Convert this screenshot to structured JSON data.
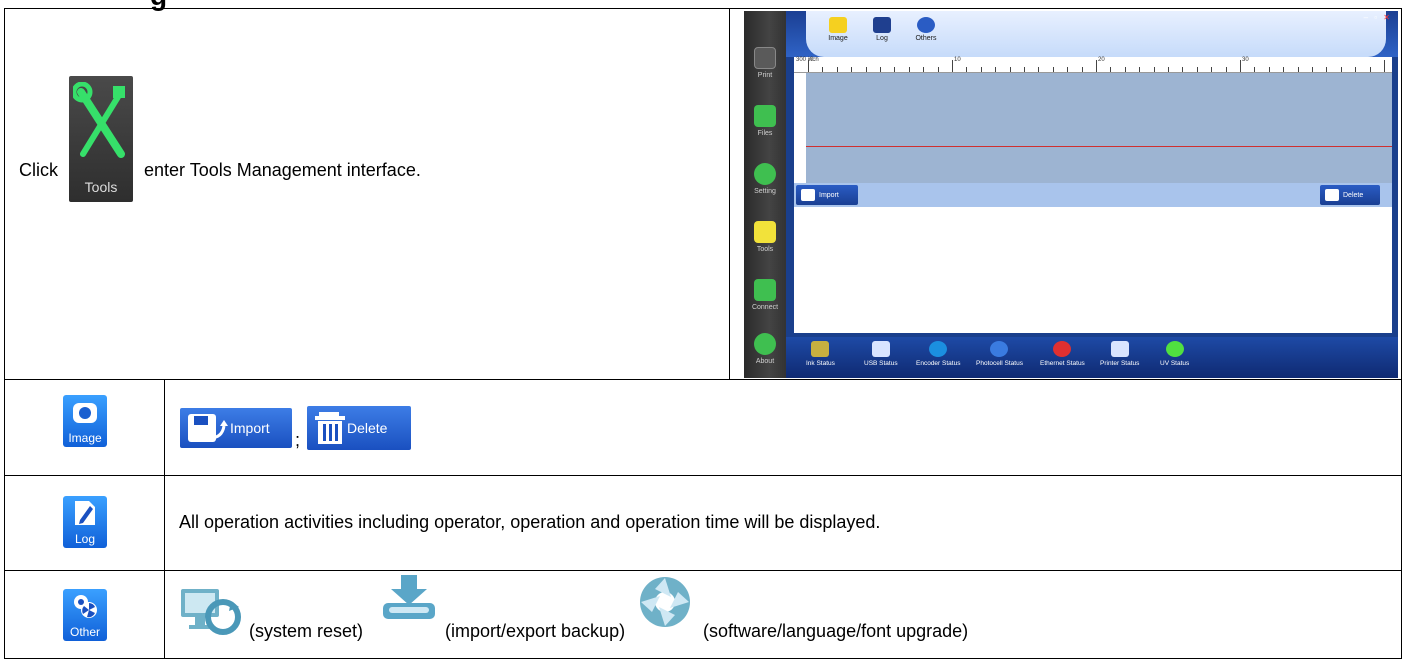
{
  "doc": {
    "heading_fragment": "g",
    "intro": {
      "before": "Click",
      "tools_icon_label": "Tools",
      "after": "enter Tools Management interface."
    },
    "app_screenshot": {
      "sidebar": [
        "Print",
        "Files",
        "Setting",
        "Tools",
        "Connect",
        "About"
      ],
      "top_buttons": [
        "Image",
        "Log",
        "Others"
      ],
      "ruler": {
        "corner": "300\ninch",
        "marks": [
          "0",
          "10",
          "20",
          "30"
        ]
      },
      "import_label": "Import",
      "delete_label": "Delete",
      "status_items": [
        "Ink Status",
        "USB Status",
        "Encoder Status",
        "Photocell Status",
        "Ethernet Status",
        "Printer Status",
        "UV Status"
      ],
      "colors": {
        "accent": "#1a3f8c",
        "canvas": "#9db4d2",
        "tools_green": "#36e06a"
      }
    },
    "rows": [
      {
        "icon_caption": "Image",
        "import_label": "Import",
        "separator": ";",
        "delete_label": "Delete"
      },
      {
        "icon_caption": "Log",
        "text": "All operation activities including operator, operation and operation time will be displayed."
      },
      {
        "icon_caption": "Other",
        "reset_label": "(system reset)",
        "backup_label": "(import/export backup)",
        "upgrade_label": "(software/language/font upgrade)"
      }
    ]
  }
}
